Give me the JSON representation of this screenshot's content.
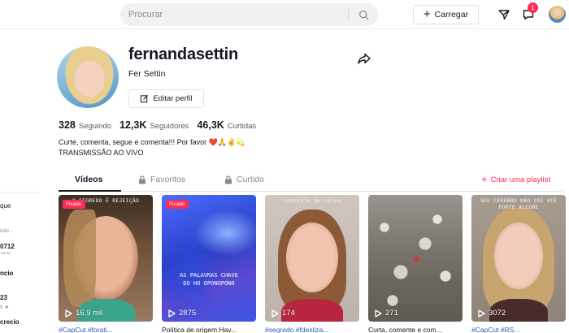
{
  "header": {
    "search_placeholder": "Procurar",
    "upload_label": "Carregar",
    "notification_count": "1"
  },
  "leftnav": {
    "items": [
      "que",
      "ndo...",
      "0712",
      "™™",
      "ncio",
      "23",
      "5 ★",
      "crecio"
    ]
  },
  "profile": {
    "username": "fernandasettin",
    "nickname": "Fer Settin",
    "edit_label": "Editar perfil",
    "stats": [
      {
        "value": "328",
        "label": "Seguindo"
      },
      {
        "value": "12,3K",
        "label": "Seguidores"
      },
      {
        "value": "46,3K",
        "label": "Curtidas"
      }
    ],
    "bio_line1": "Curte, comenta, segue e comenta!!! Por favor ❤️🙏✌️💫",
    "bio_line2": "TRANSMISSÃO AO VIVO"
  },
  "tabs": {
    "videos": "Vídeos",
    "favorites": "Favoritos",
    "liked": "Curtido",
    "create_playlist": "Criar uma playlist"
  },
  "videos": [
    {
      "overlay": "O SEGREDO É REJEIÇÃO",
      "pinned": "Fixado",
      "mid_text": "",
      "views": "16,9 mil",
      "caption": "#CapCut #forati...",
      "caption_is_tag": true
    },
    {
      "overlay": "",
      "pinned": "Fixado",
      "mid_text": "AS PALAVRAS CHAVE\nDO HO OPONOPONO",
      "views": "2875",
      "caption": "Política de origem Hav...",
      "caption_is_tag": false
    },
    {
      "overlay": "Controle de ráiva",
      "pinned": "",
      "mid_text": "",
      "views": "174",
      "caption": "#segredo #fdesliza...",
      "caption_is_tag": true
    },
    {
      "overlay": "",
      "pinned": "",
      "mid_text": "",
      "views": "271",
      "caption": "Curta, comente e com...",
      "caption_is_tag": false
    },
    {
      "overlay": "SEU CÉREBRO NÃO VAI ACE\nPORTO ALEGRE",
      "pinned": "",
      "mid_text": "",
      "views": "3072",
      "caption": "#CapCut #RS...",
      "caption_is_tag": true
    }
  ],
  "colors": {
    "accent": "#fe2c55",
    "text": "#161823",
    "muted": "#8a8b91",
    "link": "#2b5db9"
  }
}
